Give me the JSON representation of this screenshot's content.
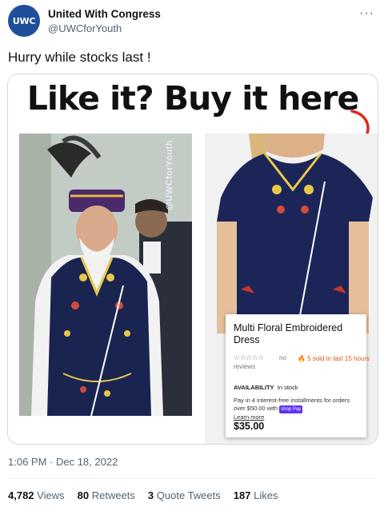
{
  "tweet": {
    "author_name": "United With Congress",
    "author_handle": "@UWCforYouth",
    "avatar_text": "UWC",
    "more_label": "···",
    "text": "Hurry while stocks last !",
    "timestamp": "1:06 PM · Dec 18, 2022"
  },
  "image": {
    "headline": "Like it? Buy it here",
    "watermark": "@UWCforYouth",
    "product": {
      "title": "Multi Floral Embroidered Dress",
      "stars": "☆☆☆☆☆",
      "reviews_line1": "no",
      "reviews_line2": "reviews",
      "sold": "5 sold in last 15 hours",
      "availability_label": "AVAILABILITY",
      "availability_value": "In stock",
      "installments": "Pay in 4 interest-free installments for orders over $50.00 with",
      "shop_pay": "shop Pay",
      "learn_more": "Learn more",
      "price": "$35.00"
    }
  },
  "stats": [
    {
      "count": "4,782",
      "label": "Views"
    },
    {
      "count": "80",
      "label": "Retweets"
    },
    {
      "count": "3",
      "label": "Quote Tweets"
    },
    {
      "count": "187",
      "label": "Likes"
    }
  ],
  "colors": {
    "accent_arrow": "#e0281f",
    "avatar_bg": "#1f4e9b",
    "muted": "#536471",
    "vest": "#1a2450"
  }
}
